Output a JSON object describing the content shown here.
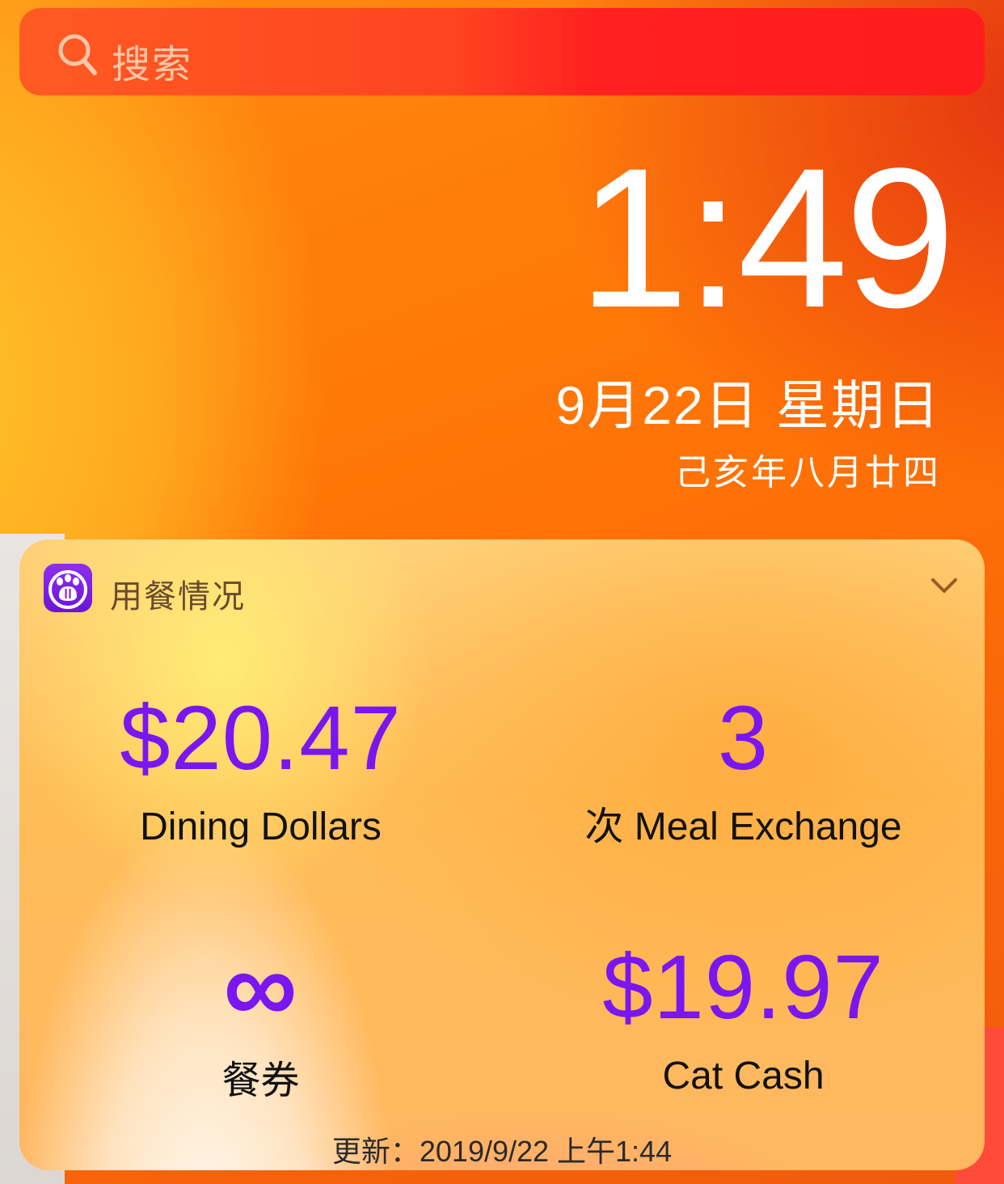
{
  "search": {
    "placeholder": "搜索",
    "icon": "search-icon"
  },
  "lockscreen": {
    "time": "1:49",
    "date": "9月22日 星期日",
    "lunar_date": "己亥年八月廿四"
  },
  "widget": {
    "title": "用餐情况",
    "app_icon": "paw-icon",
    "expand_icon": "chevron-down-icon",
    "stats": [
      {
        "value": "$20.47",
        "label": "Dining Dollars"
      },
      {
        "value": "3",
        "label": "次 Meal Exchange"
      },
      {
        "value": "∞",
        "label": "餐券"
      },
      {
        "value": "$19.97",
        "label": "Cat Cash"
      }
    ],
    "updated": "更新：2019/9/22 上午1:44"
  },
  "colors": {
    "accent_purple": "#7a16f0",
    "search_bar": "#ff3a20",
    "wallpaper_orange": "#ff7306"
  }
}
